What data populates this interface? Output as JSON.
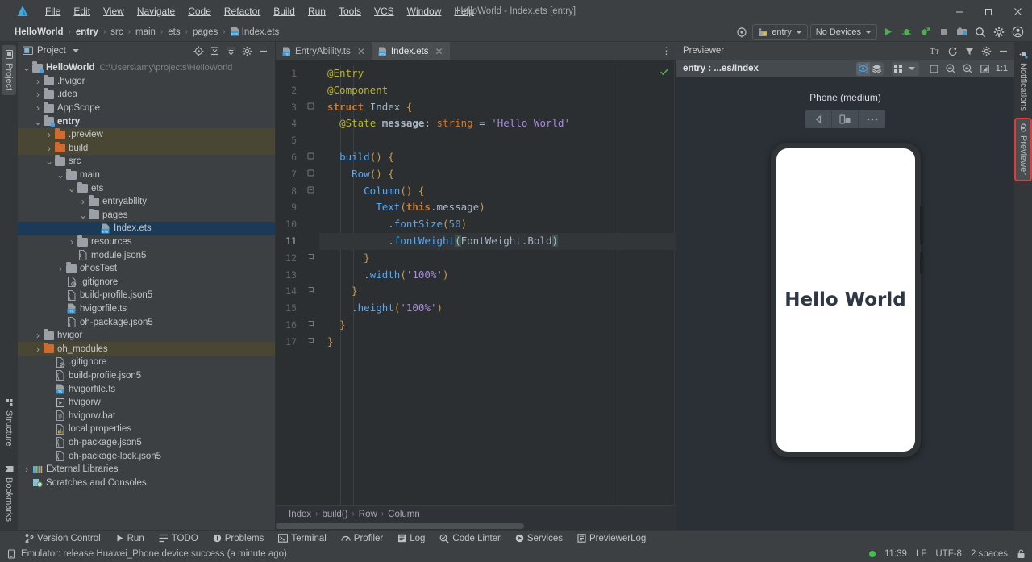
{
  "window": {
    "title": "HelloWorld - Index.ets [entry]",
    "controls": {
      "minimize": "─",
      "maximize": "❐",
      "close": "✕"
    }
  },
  "menu": [
    "File",
    "Edit",
    "View",
    "Navigate",
    "Code",
    "Refactor",
    "Build",
    "Run",
    "Tools",
    "VCS",
    "Window",
    "Help"
  ],
  "breadcrumb": {
    "items": [
      "HelloWorld",
      "entry",
      "src",
      "main",
      "ets",
      "pages",
      "Index.ets"
    ],
    "separator": "›"
  },
  "toolbar": {
    "target_icon": "target-icon",
    "module_label": "entry",
    "device_label": "No Devices",
    "run_icon": "run-icon",
    "debug_icon": "debug-icon",
    "attach_debug_icon": "attach-debugger-icon",
    "stop_icon": "stop-icon",
    "device_manager_icon": "device-manager-icon",
    "search_icon": "search-icon",
    "settings_icon": "gear-icon",
    "account_icon": "account-icon"
  },
  "left_strip": {
    "top": [
      "Project"
    ],
    "bottom": [
      "Structure",
      "Bookmarks"
    ]
  },
  "right_strip": {
    "items": [
      "Notifications",
      "Previewer"
    ],
    "highlighted": "Previewer"
  },
  "project_panel": {
    "title": "Project",
    "actions": [
      "locate-icon",
      "collapse-all-icon",
      "expand-icon",
      "gear-icon",
      "hide-icon"
    ],
    "tree": [
      {
        "depth": 0,
        "arrow": "v",
        "icon": "folder-module-gray",
        "label": "HelloWorld",
        "bold": true,
        "path": "C:\\Users\\amy\\projects\\HelloWorld"
      },
      {
        "depth": 1,
        "arrow": ">",
        "icon": "folder-gray",
        "label": ".hvigor"
      },
      {
        "depth": 1,
        "arrow": ">",
        "icon": "folder-gray",
        "label": ".idea"
      },
      {
        "depth": 1,
        "arrow": ">",
        "icon": "folder-gray",
        "label": "AppScope"
      },
      {
        "depth": 1,
        "arrow": "v",
        "icon": "folder-module-gray",
        "label": "entry",
        "bold": true
      },
      {
        "depth": 2,
        "arrow": ">",
        "icon": "folder-orange",
        "label": ".preview",
        "hi": true
      },
      {
        "depth": 2,
        "arrow": ">",
        "icon": "folder-orange",
        "label": "build",
        "hi": true
      },
      {
        "depth": 2,
        "arrow": "v",
        "icon": "folder-gray",
        "label": "src"
      },
      {
        "depth": 3,
        "arrow": "v",
        "icon": "folder-gray",
        "label": "main"
      },
      {
        "depth": 4,
        "arrow": "v",
        "icon": "folder-gray",
        "label": "ets"
      },
      {
        "depth": 5,
        "arrow": ">",
        "icon": "folder-gray",
        "label": "entryability"
      },
      {
        "depth": 5,
        "arrow": "v",
        "icon": "folder-gray",
        "label": "pages"
      },
      {
        "depth": 6,
        "arrow": "",
        "icon": "file-ets",
        "label": "Index.ets",
        "selected": true
      },
      {
        "depth": 4,
        "arrow": ">",
        "icon": "folder-gray",
        "label": "resources"
      },
      {
        "depth": 4,
        "arrow": "",
        "icon": "file-json5",
        "label": "module.json5"
      },
      {
        "depth": 3,
        "arrow": ">",
        "icon": "folder-gray",
        "label": "ohosTest"
      },
      {
        "depth": 3,
        "arrow": "",
        "icon": "file-gitignore",
        "label": ".gitignore"
      },
      {
        "depth": 3,
        "arrow": "",
        "icon": "file-json5",
        "label": "build-profile.json5"
      },
      {
        "depth": 3,
        "arrow": "",
        "icon": "file-ts",
        "label": "hvigorfile.ts"
      },
      {
        "depth": 3,
        "arrow": "",
        "icon": "file-json5",
        "label": "oh-package.json5"
      },
      {
        "depth": 1,
        "arrow": ">",
        "icon": "folder-gray",
        "label": "hvigor"
      },
      {
        "depth": 1,
        "arrow": ">",
        "icon": "folder-orange",
        "label": "oh_modules",
        "hi": true
      },
      {
        "depth": 2,
        "arrow": "",
        "icon": "file-gitignore",
        "label": ".gitignore"
      },
      {
        "depth": 2,
        "arrow": "",
        "icon": "file-json5",
        "label": "build-profile.json5"
      },
      {
        "depth": 2,
        "arrow": "",
        "icon": "file-ts",
        "label": "hvigorfile.ts"
      },
      {
        "depth": 2,
        "arrow": "",
        "icon": "file-exec",
        "label": "hvigorw"
      },
      {
        "depth": 2,
        "arrow": "",
        "icon": "file-bat",
        "label": "hvigorw.bat"
      },
      {
        "depth": 2,
        "arrow": "",
        "icon": "file-properties",
        "label": "local.properties"
      },
      {
        "depth": 2,
        "arrow": "",
        "icon": "file-json5",
        "label": "oh-package.json5"
      },
      {
        "depth": 2,
        "arrow": "",
        "icon": "file-json5",
        "label": "oh-package-lock.json5"
      },
      {
        "depth": 0,
        "arrow": ">",
        "icon": "libraries-icon",
        "label": "External Libraries"
      },
      {
        "depth": 0,
        "arrow": "",
        "icon": "scratches-icon",
        "label": "Scratches and Consoles"
      }
    ]
  },
  "editor": {
    "tabs": [
      {
        "label": "EntryAbility.ts",
        "icon": "file-ts",
        "active": false
      },
      {
        "label": "Index.ets",
        "icon": "file-ets",
        "active": true
      }
    ],
    "more_icon": "more-vertical-icon",
    "inspection_ok_icon": "inspection-ok-icon",
    "line_count": 17,
    "current_line": 11,
    "lines": [
      "@Entry",
      "@Component",
      "struct Index {",
      "  @State message: string = 'Hello World'",
      "",
      "  build() {",
      "    Row() {",
      "      Column() {",
      "        Text(this.message)",
      "          .fontSize(50)",
      "          .fontWeight(FontWeight.Bold)",
      "      }",
      "      .width('100%')",
      "    }",
      "    .height('100%')",
      "  }",
      "}"
    ],
    "breadcrumb": [
      "Index",
      "build()",
      "Row",
      "Column"
    ]
  },
  "previewer": {
    "title": "Previewer",
    "header_actions": [
      "font-size-icon",
      "refresh-icon",
      "filter-icon",
      "gear-icon",
      "hide-icon"
    ],
    "context": "entry : ...es/Index",
    "toggle_group": [
      "inspector-icon",
      "layers-icon"
    ],
    "grid_icon": "grid-icon",
    "right_tools": [
      "frame-icon",
      "zoom-out-icon",
      "zoom-in-icon",
      "fit-icon"
    ],
    "zoom_ratio": "1:1",
    "device_name": "Phone (medium)",
    "device_buttons": [
      "rotate-icon",
      "multi-device-icon",
      "more-icon"
    ],
    "screen_text": "Hello World"
  },
  "tool_windows": [
    {
      "label": "Version Control",
      "icon": "branch-icon"
    },
    {
      "label": "Run",
      "icon": "run-icon"
    },
    {
      "label": "TODO",
      "icon": "todo-icon"
    },
    {
      "label": "Problems",
      "icon": "problems-icon"
    },
    {
      "label": "Terminal",
      "icon": "terminal-icon"
    },
    {
      "label": "Profiler",
      "icon": "profiler-icon"
    },
    {
      "label": "Log",
      "icon": "log-icon"
    },
    {
      "label": "Code Linter",
      "icon": "linter-icon"
    },
    {
      "label": "Services",
      "icon": "services-icon"
    },
    {
      "label": "PreviewerLog",
      "icon": "previewerlog-icon"
    }
  ],
  "status_bar": {
    "message_icon": "device-icon",
    "message": "Emulator: release Huawei_Phone device success (a minute ago)",
    "indicator_color": "#41c052",
    "time": "11:39",
    "line_sep": "LF",
    "encoding": "UTF-8",
    "indent": "2 spaces",
    "lock_icon": "lock-icon"
  },
  "colors": {
    "accent_blue": "#4a9ee0",
    "folder_orange": "#cf6b30",
    "selection": "#1b3a57",
    "highlight_row": "#4a4634",
    "editor_bg": "#2b2f31",
    "panel_bg": "#3c4043",
    "previewer_bg": "#2b3036",
    "highlight_outline": "#e03b3b"
  }
}
